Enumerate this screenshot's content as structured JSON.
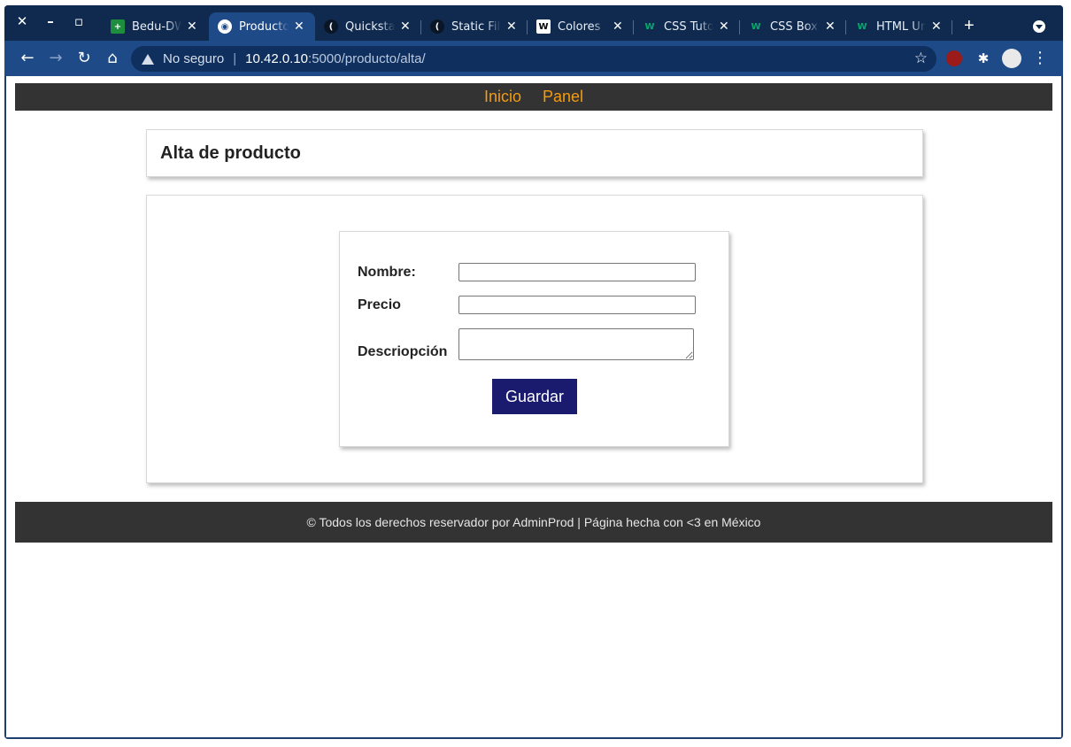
{
  "browser": {
    "tabs": [
      {
        "title": "Bedu-DW",
        "icon": "sheets-icon",
        "active": false
      },
      {
        "title": "Producto",
        "icon": "globe-icon",
        "active": true
      },
      {
        "title": "Quickstart",
        "icon": "flask-icon",
        "active": false
      },
      {
        "title": "Static Files",
        "icon": "flask-icon",
        "active": false
      },
      {
        "title": "Colores",
        "icon": "w-icon",
        "active": false
      },
      {
        "title": "CSS Tutorial",
        "icon": "w3-icon",
        "active": false
      },
      {
        "title": "CSS Box",
        "icon": "w3-icon",
        "active": false
      },
      {
        "title": "HTML Un",
        "icon": "w3-icon",
        "active": false
      }
    ],
    "security_label": "No seguro",
    "url_host": "10.42.0.10",
    "url_rest": ":5000/producto/alta/",
    "colors": {
      "frame": "#0f2a4e",
      "toolbar": "#1e4a88"
    }
  },
  "site_nav": {
    "items": [
      "Inicio",
      "Panel"
    ],
    "link_color": "#f39c12"
  },
  "page": {
    "title": "Alta de producto",
    "form": {
      "nombre_label": "Nombre:",
      "nombre_value": "",
      "precio_label": "Precio",
      "precio_value": "",
      "descripcion_label": "Descriopción",
      "descripcion_value": "",
      "save_label": "Guardar",
      "save_color": "#1a1a6e"
    }
  },
  "footer": {
    "text": "© Todos los derechos reservador por AdminProd | Página hecha con <3 en México"
  }
}
